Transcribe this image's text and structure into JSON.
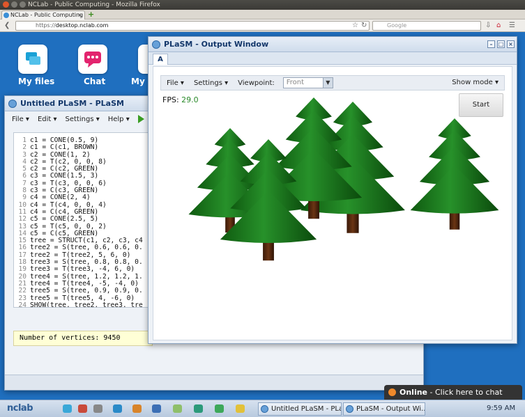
{
  "browser": {
    "window_title": "NCLab - Public Computing - Mozilla Firefox",
    "tab_title": "NCLab - Public Computing",
    "url_scheme": "https://",
    "url_host": "desktop.nclab.com",
    "search_placeholder": "Google"
  },
  "desktop": {
    "icons": [
      {
        "label": "My files",
        "icon": "folder-icon"
      },
      {
        "label": "Chat",
        "icon": "chat-icon"
      },
      {
        "label": "My a",
        "icon": "apps-icon"
      }
    ]
  },
  "editor": {
    "title": "Untitled PLaSM - PLaSM",
    "menu": [
      "File",
      "Edit",
      "Settings",
      "Help"
    ],
    "code_lines": [
      {
        "n": "1",
        "text": "c1 = CONE(0.5, 9)"
      },
      {
        "n": "2",
        "text": "c1 = C(c1, BROWN)"
      },
      {
        "n": "3",
        "text": "c2 = CONE(1, 2)"
      },
      {
        "n": "4",
        "text": "c2 = T(c2, 0, 0, 8)"
      },
      {
        "n": "5",
        "text": "c2 = C(c2, GREEN)"
      },
      {
        "n": "6",
        "text": "c3 = CONE(1.5, 3)"
      },
      {
        "n": "7",
        "text": "c3 = T(c3, 0, 0, 6)"
      },
      {
        "n": "8",
        "text": "c3 = C(c3, GREEN)"
      },
      {
        "n": "9",
        "text": "c4 = CONE(2, 4)"
      },
      {
        "n": "10",
        "text": "c4 = T(c4, 0, 0, 4)"
      },
      {
        "n": "11",
        "text": "c4 = C(c4, GREEN)"
      },
      {
        "n": "12",
        "text": "c5 = CONE(2.5, 5)"
      },
      {
        "n": "13",
        "text": "c5 = T(c5, 0, 0, 2)"
      },
      {
        "n": "14",
        "text": "c5 = C(c5, GREEN)"
      },
      {
        "n": "15",
        "text": "tree = STRUCT(c1, c2, c3, c4"
      },
      {
        "n": "16",
        "text": "tree2 = S(tree, 0.6, 0.6, 0."
      },
      {
        "n": "17",
        "text": "tree2 = T(tree2, 5, 6, 0)"
      },
      {
        "n": "18",
        "text": "tree3 = S(tree, 0.8, 0.8, 0."
      },
      {
        "n": "19",
        "text": "tree3 = T(tree3, -4, 6, 0)"
      },
      {
        "n": "20",
        "text": "tree4 = S(tree, 1.2, 1.2, 1."
      },
      {
        "n": "21",
        "text": "tree4 = T(tree4, -5, -4, 0)"
      },
      {
        "n": "22",
        "text": "tree5 = S(tree, 0.9, 0.9, 0."
      },
      {
        "n": "23",
        "text": "tree5 = T(tree5, 4, -6, 0)"
      },
      {
        "n": "24",
        "text": "SHOW(tree, tree2, tree3, tre"
      }
    ],
    "output": "Number of vertices: 9450"
  },
  "viewer": {
    "title": "PLaSM - Output Window",
    "tab": "A",
    "menu_file": "File",
    "menu_settings": "Settings",
    "viewpoint_label": "Viewpoint:",
    "viewpoint_value": "Front",
    "show_mode": "Show mode",
    "fps_label": "FPS:",
    "fps_value": "29.0",
    "start_label": "Start"
  },
  "chat": {
    "status": "Online",
    "text": " - Click here to chat"
  },
  "taskbar": {
    "logo": "nclab",
    "tasks": [
      "Untitled PLaSM - PLaSM",
      "PLaSM - Output Wi..."
    ],
    "clock": "9:59 AM"
  },
  "colors": {
    "desktop": "#1f6fbf",
    "tree_green": "#1e7a1e",
    "trunk_brown": "#5a2a0f"
  }
}
